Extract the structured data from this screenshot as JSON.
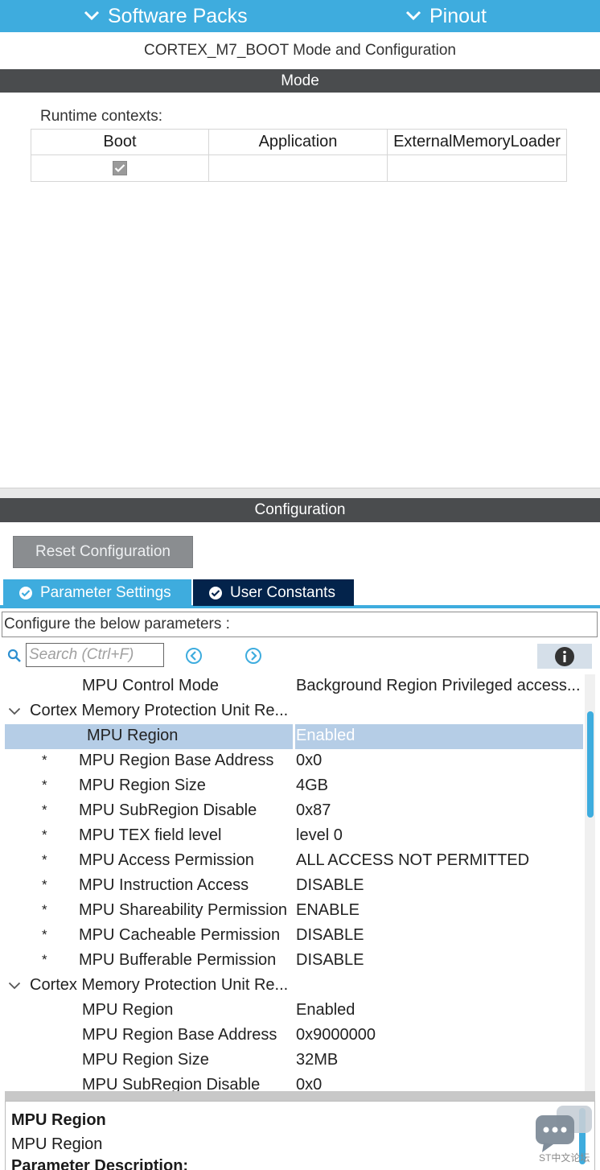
{
  "top_bar": {
    "software_packs_label": "Software Packs",
    "pinout_label": "Pinout",
    "chevron_icon": "chevron-down-icon",
    "background_color": "#3eacde"
  },
  "peripheral_title": "CORTEX_M7_BOOT Mode and Configuration",
  "mode_section": {
    "title": "Mode",
    "runtime_contexts_label": "Runtime contexts:",
    "columns": [
      "Boot",
      "Application",
      "ExternalMemoryLoader"
    ],
    "checked": [
      true,
      false,
      false
    ]
  },
  "configuration_section": {
    "title": "Configuration",
    "reset_button_label": "Reset Configuration",
    "tabs": [
      {
        "label": "Parameter Settings",
        "active": true,
        "icon": "check-circle-icon"
      },
      {
        "label": "User Constants",
        "active": false,
        "icon": "check-circle-icon"
      }
    ],
    "hint_text": "Configure the below parameters :",
    "search_placeholder": "Search (Ctrl+F)",
    "tree": [
      {
        "type": "param",
        "star": false,
        "name": "MPU Control Mode",
        "value": "Background Region Privileged access..."
      },
      {
        "type": "group",
        "name": "Cortex Memory Protection Unit Re..."
      },
      {
        "type": "param",
        "star": false,
        "name": "MPU Region",
        "value": "Enabled",
        "selected": true
      },
      {
        "type": "param",
        "star": true,
        "name": "MPU Region Base Address",
        "value": "0x0"
      },
      {
        "type": "param",
        "star": true,
        "name": "MPU Region Size",
        "value": "4GB"
      },
      {
        "type": "param",
        "star": true,
        "name": "MPU SubRegion Disable",
        "value": "0x87"
      },
      {
        "type": "param",
        "star": true,
        "name": "MPU TEX field level",
        "value": "level 0"
      },
      {
        "type": "param",
        "star": true,
        "name": "MPU Access Permission",
        "value": "ALL ACCESS NOT PERMITTED"
      },
      {
        "type": "param",
        "star": true,
        "name": "MPU Instruction Access",
        "value": "DISABLE"
      },
      {
        "type": "param",
        "star": true,
        "name": "MPU Shareability Permission",
        "value": "ENABLE"
      },
      {
        "type": "param",
        "star": true,
        "name": "MPU Cacheable Permission",
        "value": "DISABLE"
      },
      {
        "type": "param",
        "star": true,
        "name": "MPU Bufferable  Permission",
        "value": "DISABLE"
      },
      {
        "type": "group",
        "name": "Cortex Memory Protection Unit Re..."
      },
      {
        "type": "param",
        "star": false,
        "name": "MPU Region",
        "value": "Enabled"
      },
      {
        "type": "param",
        "star": false,
        "name": "MPU Region Base Address",
        "value": "0x9000000"
      },
      {
        "type": "param",
        "star": false,
        "name": "MPU Region Size",
        "value": "32MB"
      },
      {
        "type": "param",
        "star": false,
        "name": "MPU SubRegion Disable",
        "value": "0x0"
      }
    ],
    "description": {
      "title": "MPU Region",
      "subtitle": "MPU Region",
      "heading": "Parameter Description:"
    }
  },
  "watermark": {
    "text": "ST中文论坛",
    "icon": "chat-bubble-icon"
  }
}
